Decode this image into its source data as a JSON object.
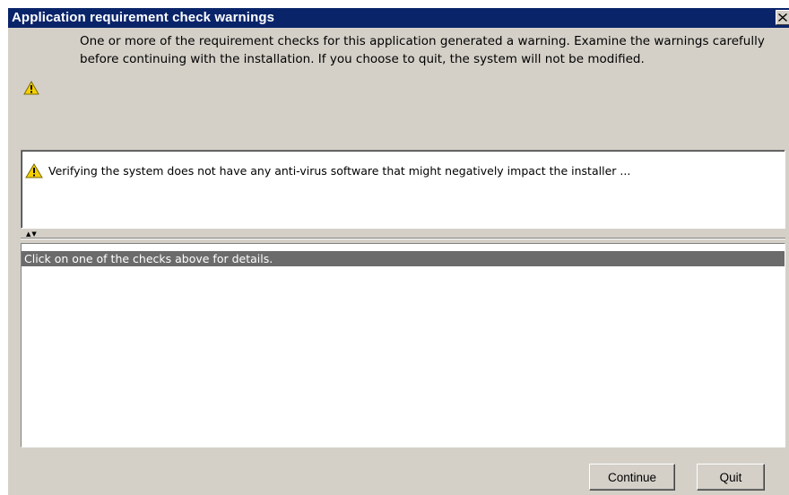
{
  "window": {
    "title": "Application requirement check warnings",
    "close_glyph": "✕"
  },
  "message": {
    "icon": "warning-icon",
    "text": "One or more of the requirement checks for this application generated a warning. Examine the warnings carefully before continuing with the installation. If you choose to quit, the system will not be modified."
  },
  "checks": {
    "items": [
      {
        "icon": "warning-icon",
        "label": "Verifying the system does not have any anti-virus software that might negatively impact the installer ..."
      }
    ]
  },
  "details": {
    "header": "Click on one of the checks above for details."
  },
  "buttons": {
    "continue_label": "Continue",
    "quit_label": "Quit"
  },
  "colors": {
    "titlebar": "#0a246a",
    "window_bg": "#d4d0c8",
    "details_header_bg": "#6b6b6b",
    "warning_yellow": "#f5d000"
  }
}
